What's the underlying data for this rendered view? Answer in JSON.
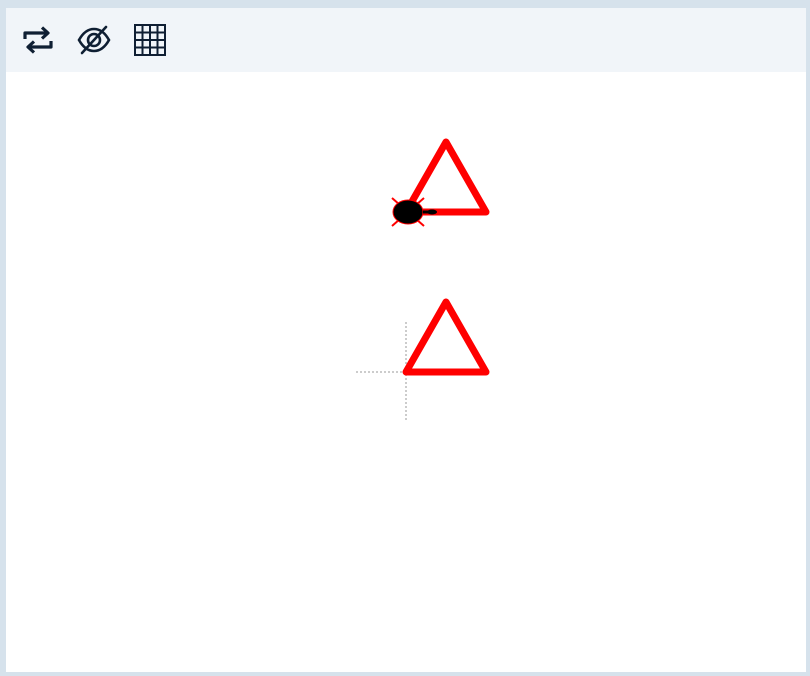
{
  "toolbar": {
    "buttons": [
      {
        "name": "repeat-button",
        "icon": "repeat-icon"
      },
      {
        "name": "hide-button",
        "icon": "eye-slash-icon"
      },
      {
        "name": "grid-button",
        "icon": "grid-icon"
      }
    ]
  },
  "canvas": {
    "stroke_color": "#ff0000",
    "turtle_color": "#000000",
    "turtle_outline": "#ff0000",
    "crosshair_color": "#999999",
    "shapes": [
      {
        "name": "upper-triangle",
        "shape": "triangle"
      },
      {
        "name": "lower-triangle",
        "shape": "triangle"
      }
    ],
    "turtle": {
      "heading": "east"
    }
  }
}
